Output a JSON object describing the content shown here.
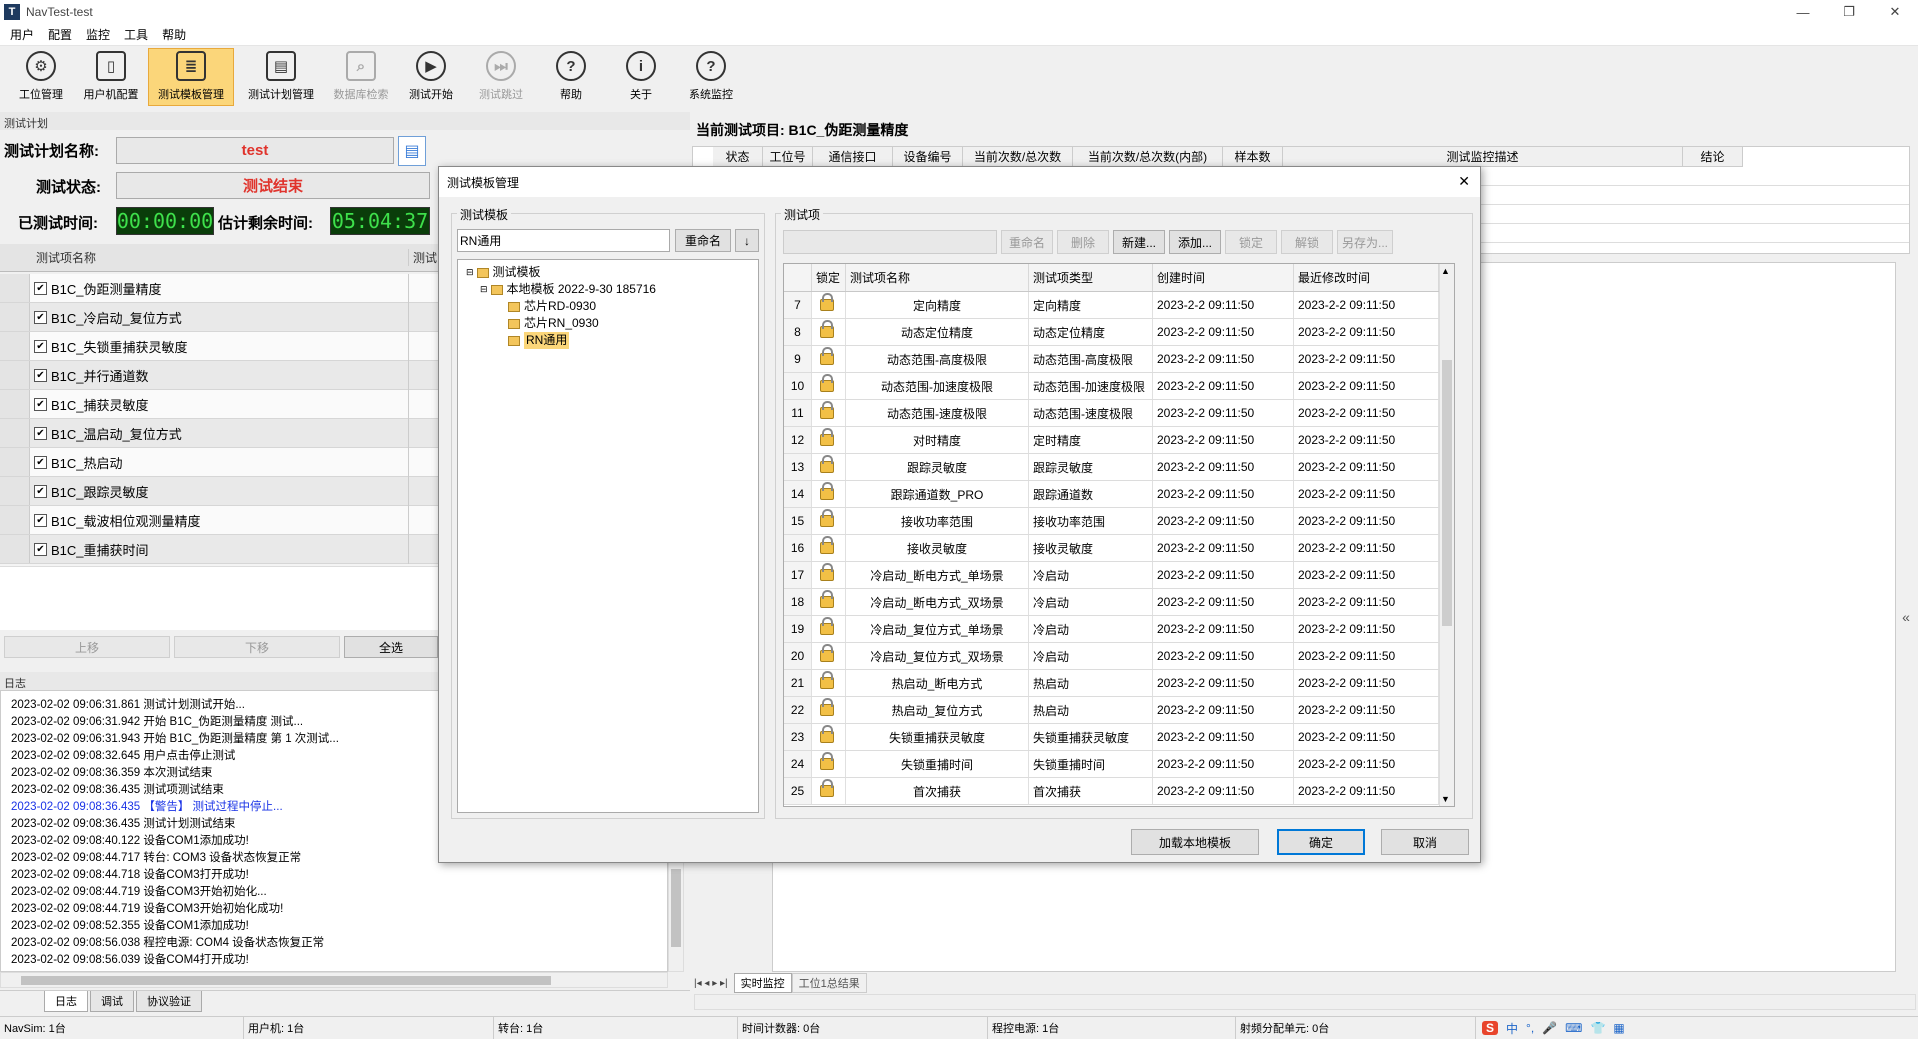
{
  "window": {
    "title": "NavTest-test",
    "minimize": "—",
    "restore": "❐",
    "close": "✕"
  },
  "menu": [
    "用户",
    "配置",
    "监控",
    "工具",
    "帮助"
  ],
  "toolbar": [
    {
      "label": "工位管理",
      "icon": "gear-icon",
      "glyph": "⚙",
      "active": false,
      "disabled": false
    },
    {
      "label": "用户机配置",
      "icon": "phone-settings-icon",
      "glyph": "▯",
      "active": false,
      "disabled": false
    },
    {
      "label": "测试模板管理",
      "icon": "template-icon",
      "glyph": "≣",
      "active": true,
      "disabled": false
    },
    {
      "label": "测试计划管理",
      "icon": "plan-icon",
      "glyph": "▤",
      "active": false,
      "disabled": false
    },
    {
      "label": "数据库检索",
      "icon": "database-search-icon",
      "glyph": "⌕",
      "active": false,
      "disabled": true
    },
    {
      "label": "测试开始",
      "icon": "play-icon",
      "glyph": "▶",
      "active": false,
      "disabled": false
    },
    {
      "label": "测试跳过",
      "icon": "skip-icon",
      "glyph": "⏭",
      "active": false,
      "disabled": true
    },
    {
      "label": "帮助",
      "icon": "help-icon",
      "glyph": "?",
      "active": false,
      "disabled": false
    },
    {
      "label": "关于",
      "icon": "info-icon",
      "glyph": "i",
      "active": false,
      "disabled": false
    },
    {
      "label": "系统监控",
      "icon": "system-monitor-icon",
      "glyph": "?",
      "active": false,
      "disabled": false
    }
  ],
  "plan": {
    "section_title": "测试计划",
    "name_label": "测试计划名称:",
    "name_value": "test",
    "status_label": "测试状态:",
    "status_value": "测试结束",
    "elapsed_label": "已测试时间:",
    "elapsed_value": "00:00:00",
    "remaining_label": "估计剩余时间:",
    "remaining_value": "05:04:37",
    "grid_col1": "测试项名称",
    "grid_col2": "测试",
    "items": [
      "B1C_伪距测量精度",
      "B1C_冷启动_复位方式",
      "B1C_失锁重捕获灵敏度",
      "B1C_并行通道数",
      "B1C_捕获灵敏度",
      "B1C_温启动_复位方式",
      "B1C_热启动",
      "B1C_跟踪灵敏度",
      "B1C_载波相位观测量精度",
      "B1C_重捕获时间"
    ],
    "btn_up": "上移",
    "btn_down": "下移",
    "btn_all": "全选"
  },
  "log": {
    "title": "日志",
    "lines": [
      {
        "text": "2023-02-02 09:06:31.861 测试计划测试开始...",
        "warn": false
      },
      {
        "text": "2023-02-02 09:06:31.942 开始 B1C_伪距测量精度 测试...",
        "warn": false
      },
      {
        "text": "2023-02-02 09:06:31.943 开始 B1C_伪距测量精度 第 1 次测试...",
        "warn": false
      },
      {
        "text": "2023-02-02 09:08:32.645 用户点击停止测试",
        "warn": false
      },
      {
        "text": "2023-02-02 09:08:36.359 本次测试结束",
        "warn": false
      },
      {
        "text": "2023-02-02 09:08:36.435 测试项测试结束",
        "warn": false
      },
      {
        "text": "2023-02-02 09:08:36.435 【警告】 测试过程中停止...",
        "warn": true
      },
      {
        "text": "2023-02-02 09:08:36.435 测试计划测试结束",
        "warn": false
      },
      {
        "text": "2023-02-02 09:08:40.122 设备COM1添加成功!",
        "warn": false
      },
      {
        "text": "2023-02-02 09:08:44.717 转台: COM3 设备状态恢复正常",
        "warn": false
      },
      {
        "text": "2023-02-02 09:08:44.718 设备COM3打开成功!",
        "warn": false
      },
      {
        "text": "2023-02-02 09:08:44.719 设备COM3开始初始化...",
        "warn": false
      },
      {
        "text": "2023-02-02 09:08:44.719 设备COM3开始初始化成功!",
        "warn": false
      },
      {
        "text": "2023-02-02 09:08:52.355 设备COM1添加成功!",
        "warn": false
      },
      {
        "text": "2023-02-02 09:08:56.038 程控电源: COM4 设备状态恢复正常",
        "warn": false
      },
      {
        "text": "2023-02-02 09:08:56.039 设备COM4打开成功!",
        "warn": false
      }
    ],
    "tabs": [
      "日志",
      "调试",
      "协议验证"
    ]
  },
  "current": {
    "title": "当前测试项目: B1C_伪距测量精度",
    "columns": [
      "状态",
      "工位号",
      "通信接口",
      "设备编号",
      "当前次数/总次数",
      "当前次数/总次数(内部)",
      "样本数",
      "测试监控描述",
      "结论"
    ],
    "bottom_tabs": [
      "实时监控",
      "工位1总结果"
    ]
  },
  "dialog": {
    "title": "测试模板管理",
    "close": "✕",
    "template_group": "测试模板",
    "template_name": "RN通用",
    "rename_btn": "重命名",
    "sort_btn": "↓",
    "tree": {
      "root": "测试模板",
      "local": "本地模板 2022-9-30 185716",
      "children": [
        "芯片RD-0930",
        "芯片RN_0930",
        "RN通用"
      ]
    },
    "items_group": "测试项",
    "item_buttons": [
      {
        "label": "重命名",
        "disabled": true
      },
      {
        "label": "删除",
        "disabled": true
      },
      {
        "label": "新建...",
        "disabled": false
      },
      {
        "label": "添加...",
        "disabled": false
      },
      {
        "label": "锁定",
        "disabled": true
      },
      {
        "label": "解锁",
        "disabled": true
      },
      {
        "label": "另存为...",
        "disabled": true
      }
    ],
    "table_headers": [
      "锁定",
      "测试项名称",
      "测试项类型",
      "创建时间",
      "最近修改时间"
    ],
    "rows": [
      {
        "no": "7",
        "name": "定向精度",
        "type": "定向精度",
        "created": "2023-2-2 09:11:50",
        "modified": "2023-2-2 09:11:50"
      },
      {
        "no": "8",
        "name": "动态定位精度",
        "type": "动态定位精度",
        "created": "2023-2-2 09:11:50",
        "modified": "2023-2-2 09:11:50"
      },
      {
        "no": "9",
        "name": "动态范围-高度极限",
        "type": "动态范围-高度极限",
        "created": "2023-2-2 09:11:50",
        "modified": "2023-2-2 09:11:50"
      },
      {
        "no": "10",
        "name": "动态范围-加速度极限",
        "type": "动态范围-加速度极限",
        "created": "2023-2-2 09:11:50",
        "modified": "2023-2-2 09:11:50"
      },
      {
        "no": "11",
        "name": "动态范围-速度极限",
        "type": "动态范围-速度极限",
        "created": "2023-2-2 09:11:50",
        "modified": "2023-2-2 09:11:50"
      },
      {
        "no": "12",
        "name": "对时精度",
        "type": "定时精度",
        "created": "2023-2-2 09:11:50",
        "modified": "2023-2-2 09:11:50"
      },
      {
        "no": "13",
        "name": "跟踪灵敏度",
        "type": "跟踪灵敏度",
        "created": "2023-2-2 09:11:50",
        "modified": "2023-2-2 09:11:50"
      },
      {
        "no": "14",
        "name": "跟踪通道数_PRO",
        "type": "跟踪通道数",
        "created": "2023-2-2 09:11:50",
        "modified": "2023-2-2 09:11:50"
      },
      {
        "no": "15",
        "name": "接收功率范围",
        "type": "接收功率范围",
        "created": "2023-2-2 09:11:50",
        "modified": "2023-2-2 09:11:50"
      },
      {
        "no": "16",
        "name": "接收灵敏度",
        "type": "接收灵敏度",
        "created": "2023-2-2 09:11:50",
        "modified": "2023-2-2 09:11:50"
      },
      {
        "no": "17",
        "name": "冷启动_断电方式_单场景",
        "type": "冷启动",
        "created": "2023-2-2 09:11:50",
        "modified": "2023-2-2 09:11:50"
      },
      {
        "no": "18",
        "name": "冷启动_断电方式_双场景",
        "type": "冷启动",
        "created": "2023-2-2 09:11:50",
        "modified": "2023-2-2 09:11:50"
      },
      {
        "no": "19",
        "name": "冷启动_复位方式_单场景",
        "type": "冷启动",
        "created": "2023-2-2 09:11:50",
        "modified": "2023-2-2 09:11:50"
      },
      {
        "no": "20",
        "name": "冷启动_复位方式_双场景",
        "type": "冷启动",
        "created": "2023-2-2 09:11:50",
        "modified": "2023-2-2 09:11:50"
      },
      {
        "no": "21",
        "name": "热启动_断电方式",
        "type": "热启动",
        "created": "2023-2-2 09:11:50",
        "modified": "2023-2-2 09:11:50"
      },
      {
        "no": "22",
        "name": "热启动_复位方式",
        "type": "热启动",
        "created": "2023-2-2 09:11:50",
        "modified": "2023-2-2 09:11:50"
      },
      {
        "no": "23",
        "name": "失锁重捕获灵敏度",
        "type": "失锁重捕获灵敏度",
        "created": "2023-2-2 09:11:50",
        "modified": "2023-2-2 09:11:50"
      },
      {
        "no": "24",
        "name": "失锁重捕时间",
        "type": "失锁重捕时间",
        "created": "2023-2-2 09:11:50",
        "modified": "2023-2-2 09:11:50"
      },
      {
        "no": "25",
        "name": "首次捕获",
        "type": "首次捕获",
        "created": "2023-2-2 09:11:50",
        "modified": "2023-2-2 09:11:50"
      }
    ],
    "btn_load": "加载本地模板",
    "btn_ok": "确定",
    "btn_cancel": "取消"
  },
  "status": [
    "NavSim: 1台",
    "用户机: 1台",
    "转台: 1台",
    "时间计数器: 0台",
    "程控电源: 1台",
    "射频分配单元: 0台"
  ],
  "ime": [
    "中",
    "°,",
    "🎤",
    "⌨",
    "👕",
    "▦"
  ],
  "colors": {
    "accent": "#fbd67a",
    "status_red": "#e0332c",
    "lcd_green": "#3ee04b",
    "warn_blue": "#1a33e6"
  }
}
